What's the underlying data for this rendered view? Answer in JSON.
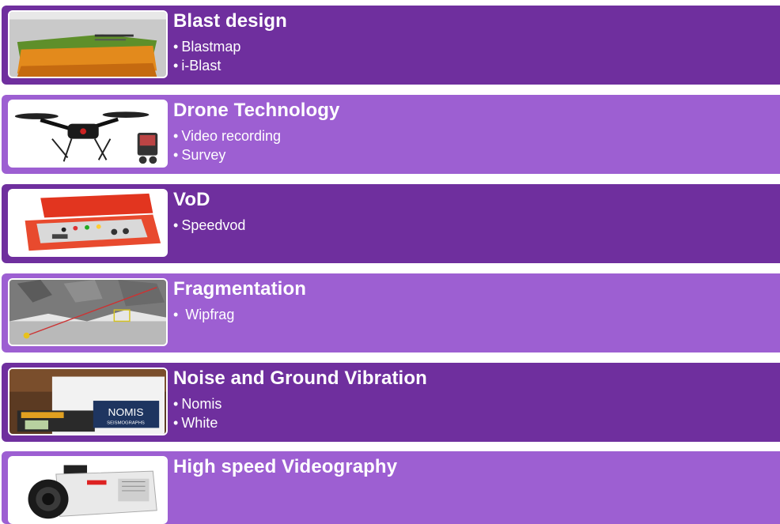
{
  "sections": [
    {
      "title": "Blast design",
      "items": [
        "Blastmap",
        "i-Blast"
      ]
    },
    {
      "title": "Drone Technology",
      "items": [
        "Video recording",
        "Survey"
      ]
    },
    {
      "title": "VoD",
      "items": [
        "Speedvod"
      ]
    },
    {
      "title": "Fragmentation",
      "items": [
        " Wipfrag"
      ]
    },
    {
      "title": "Noise and Ground Vibration",
      "items": [
        "Nomis",
        "White"
      ]
    },
    {
      "title": "High speed Videography",
      "items": []
    }
  ],
  "thumbnails": {
    "noise_badge_brand": "NOMIS",
    "noise_badge_sub": "SEISMOGRAPHS"
  },
  "colors": {
    "dark_band": "#6f2f9e",
    "light_band": "#9d5fd2",
    "text": "#ffffff"
  }
}
